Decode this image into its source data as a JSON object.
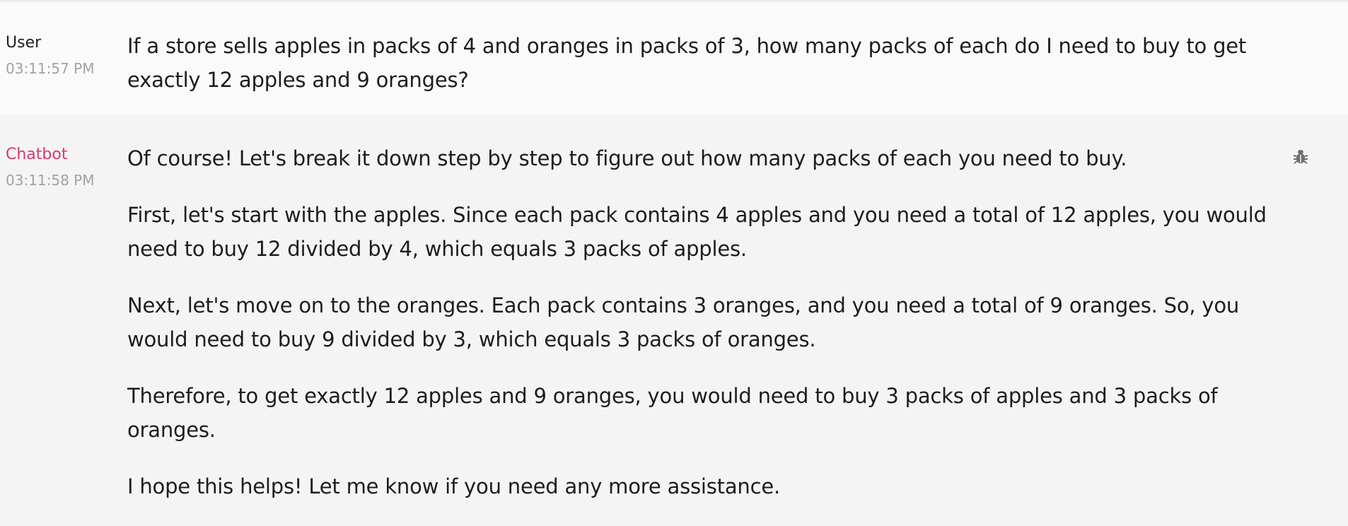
{
  "messages": [
    {
      "role": "user",
      "author": "User",
      "time": "03:11:57 PM",
      "paragraphs": [
        "If a store sells apples in packs of 4 and oranges in packs of 3, how many packs of each do I need to buy to get exactly 12 apples and 9 oranges?"
      ]
    },
    {
      "role": "bot",
      "author": "Chatbot",
      "time": "03:11:58 PM",
      "paragraphs": [
        "Of course! Let's break it down step by step to figure out how many packs of each you need to buy.",
        "First, let's start with the apples. Since each pack contains 4 apples and you need a total of 12 apples, you would need to buy 12 divided by 4, which equals 3 packs of apples.",
        "Next, let's move on to the oranges. Each pack contains 3 oranges, and you need a total of 9 oranges. So, you would need to buy 9 divided by 3, which equals 3 packs of oranges.",
        "Therefore, to get exactly 12 apples and 9 oranges, you would need to buy 3 packs of apples and 3 packs of oranges.",
        "I hope this helps! Let me know if you need any more assistance."
      ],
      "action_icon": "bug-icon"
    }
  ],
  "colors": {
    "bot_author": "#d63a6d",
    "timestamp": "#a2a2a2",
    "user_bg": "#fafafa",
    "bot_bg": "#f4f4f4"
  }
}
